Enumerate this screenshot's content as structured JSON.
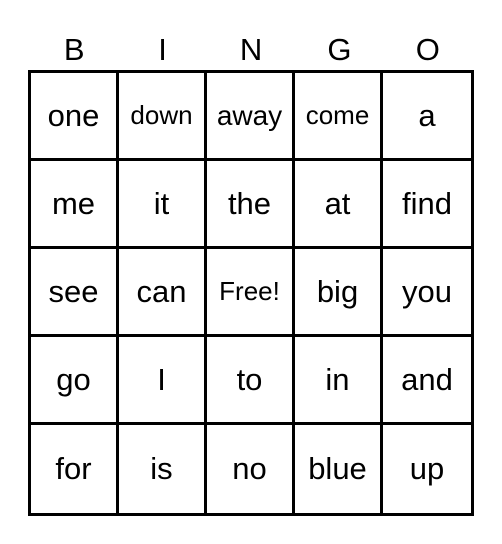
{
  "header": [
    "B",
    "I",
    "N",
    "G",
    "O"
  ],
  "cells": [
    "one",
    "down",
    "away",
    "come",
    "a",
    "me",
    "it",
    "the",
    "at",
    "find",
    "see",
    "can",
    "Free!",
    "big",
    "you",
    "go",
    "I",
    "to",
    "in",
    "and",
    "for",
    "is",
    "no",
    "blue",
    "up"
  ]
}
